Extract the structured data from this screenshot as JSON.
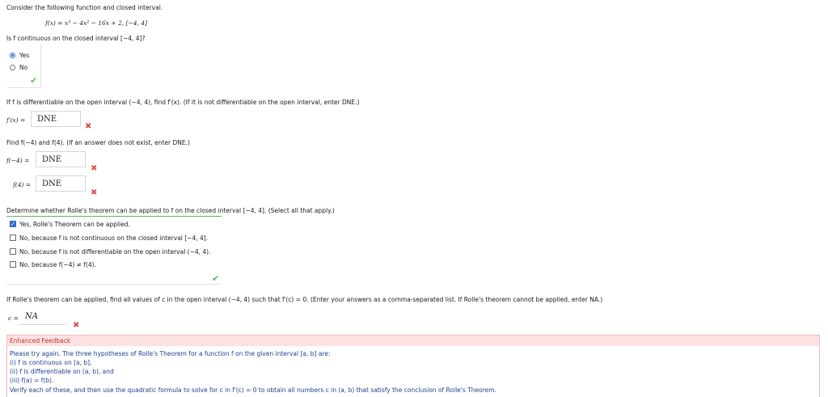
{
  "intro": "Consider the following function and closed interval.",
  "function_def": "f(x) = x³ − 4x² − 16x + 2,    [−4, 4]",
  "q1": {
    "prompt": "Is f continuous on the closed interval [−4, 4]?",
    "options": [
      "Yes",
      "No"
    ],
    "selected": "Yes",
    "result_icon": "check-icon"
  },
  "q2": {
    "prompt": "If f is differentiable on the open interval (−4, 4), find f′(x). (If it is not differentiable on the open interval, enter DNE.)",
    "label": "f′(x) =",
    "answer": "DNE",
    "result_icon": "x-icon"
  },
  "q3": {
    "prompt": "Find f(−4) and f(4). (If an answer does not exist, enter DNE.)",
    "fields": [
      {
        "label": "f(−4) =",
        "answer": "DNE"
      },
      {
        "label": "f(4) =",
        "answer": "DNE"
      }
    ],
    "result_icon": "x-icon"
  },
  "q4": {
    "prompt": "Determine whether Rolle's theorem can be applied to f on the closed interval [−4, 4]. (Select all that apply.)",
    "options": [
      {
        "label": "Yes, Rolle's Theorem can be applied.",
        "checked": true
      },
      {
        "label": "No, because f is not continuous on the closed interval [−4, 4].",
        "checked": false
      },
      {
        "label": "No, because f is not differentiable on the open interval (−4, 4).",
        "checked": false
      },
      {
        "label": "No, because f(−4) ≠ f(4).",
        "checked": false
      }
    ],
    "result_icon": "check-icon"
  },
  "q5": {
    "prompt": "If Rolle's theorem can be applied, find all values of c in the open interval (−4, 4) such that f′(c) = 0. (Enter your answers as a comma-separated list. If Rolle's theorem cannot be applied, enter NA.)",
    "label": "c =",
    "answer": "NA",
    "result_icon": "x-icon"
  },
  "feedback": {
    "header": "Enhanced Feedback",
    "lines": [
      "Please try again. The three hypotheses of Rolle's Theorem for a function f on the given interval [a, b] are:",
      "(i) f is continuous on [a, b],",
      "(ii) f is differentiable on (a, b), and",
      "(iii) f(a) = f(b).",
      "Verify each of these, and then use the quadratic formula to solve for c in f′(c) = 0 to obtain all numbers c in (a, b) that satisfy the conclusion of Rolle's Theorem."
    ]
  },
  "colors": {
    "correct": "#5cb85c",
    "incorrect": "#d9534f",
    "selected": "#2f6fd3",
    "feedback_bg": "#fbe1e1",
    "feedback_text": "#1f3f8f"
  }
}
